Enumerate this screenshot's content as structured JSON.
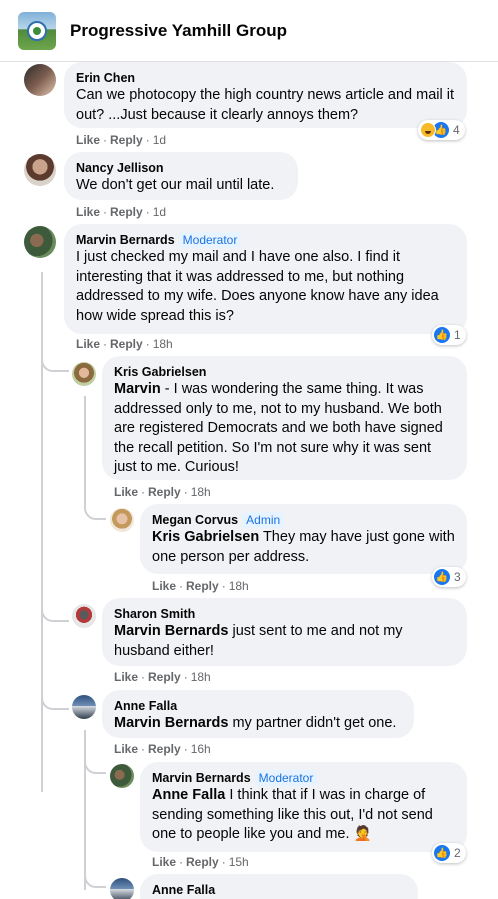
{
  "header": {
    "group_name": "Progressive Yamhill Group"
  },
  "colors": {
    "bubble": "#f0f2f5",
    "accent": "#1877f2",
    "meta": "#65676b"
  },
  "comments": [
    {
      "author": "Erin Chen",
      "text": "Can we photocopy the high country news article and mail it out? ...Just because it clearly annoys them?",
      "like": "Like",
      "reply": "Reply",
      "time": "1d",
      "reaction_icons": [
        "haha-icon",
        "like-icon"
      ],
      "reaction_count": "4"
    },
    {
      "author": "Nancy Jellison",
      "text": "We don't get our mail until late.",
      "like": "Like",
      "reply": "Reply",
      "time": "1d"
    },
    {
      "author": "Marvin Bernards",
      "role": "Moderator",
      "text": "I just checked my mail and I have one also. I find it interesting that it was addressed to me, but nothing addressed to my wife. Does anyone know have any idea how wide spread this is?",
      "like": "Like",
      "reply": "Reply",
      "time": "18h",
      "reaction_icons": [
        "like-icon"
      ],
      "reaction_count": "1"
    },
    {
      "author": "Kris Gabrielsen",
      "mention": "Marvin",
      "text": " - I was wondering the same thing. It was addressed only to me, not to my husband. We both are registered Democrats and we both have signed the recall petition. So I'm not sure why it was sent just to me. Curious!",
      "like": "Like",
      "reply": "Reply",
      "time": "18h"
    },
    {
      "author": "Megan Corvus",
      "role": "Admin",
      "mention": "Kris Gabrielsen",
      "text": " They may have just gone with one person per address.",
      "like": "Like",
      "reply": "Reply",
      "time": "18h",
      "reaction_icons": [
        "like-icon"
      ],
      "reaction_count": "3"
    },
    {
      "author": "Sharon Smith",
      "mention": "Marvin Bernards",
      "text": " just sent to me and not my husband either!",
      "like": "Like",
      "reply": "Reply",
      "time": "18h"
    },
    {
      "author": "Anne Falla",
      "mention": "Marvin Bernards",
      "text": " my partner didn't get one.",
      "like": "Like",
      "reply": "Reply",
      "time": "16h"
    },
    {
      "author": "Marvin Bernards",
      "role": "Moderator",
      "mention": "Anne Falla",
      "text": " I think that if I was in charge of sending something like this out, I'd not send one to people like you and me. 🤦",
      "like": "Like",
      "reply": "Reply",
      "time": "15h",
      "reaction_icons": [
        "like-icon"
      ],
      "reaction_count": "2"
    },
    {
      "author": "Anne Falla"
    }
  ]
}
